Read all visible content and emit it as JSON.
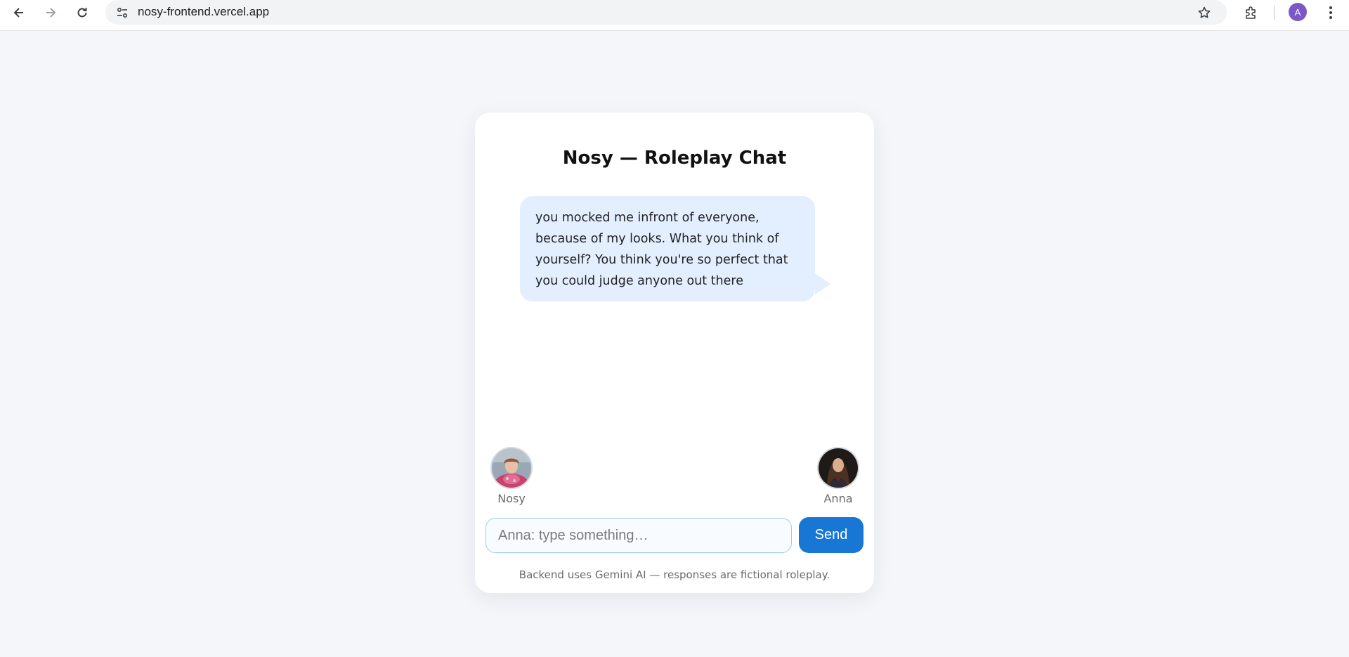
{
  "browser": {
    "url": "nosy-frontend.vercel.app",
    "profile_initial": "A"
  },
  "chat": {
    "title": "Nosy — Roleplay Chat",
    "messages": [
      {
        "text": "you mocked me infront of everyone, because of my looks. What you think of yourself? You think you're so perfect that you could judge anyone out there"
      }
    ],
    "participants": {
      "left": {
        "name": "Nosy"
      },
      "right": {
        "name": "Anna"
      }
    },
    "input": {
      "value": "",
      "placeholder": "Anna: type something…"
    },
    "send_label": "Send",
    "footer": "Backend uses Gemini AI — responses are fictional roleplay."
  },
  "colors": {
    "page_background": "#f4f6fa",
    "bubble": "#e3efff",
    "send_button": "#1877d5",
    "profile_avatar": "#7b57c7"
  },
  "icons": [
    "back-arrow-icon",
    "forward-arrow-icon",
    "reload-icon",
    "site-settings-icon",
    "star-icon",
    "extensions-icon",
    "more-menu-icon"
  ]
}
